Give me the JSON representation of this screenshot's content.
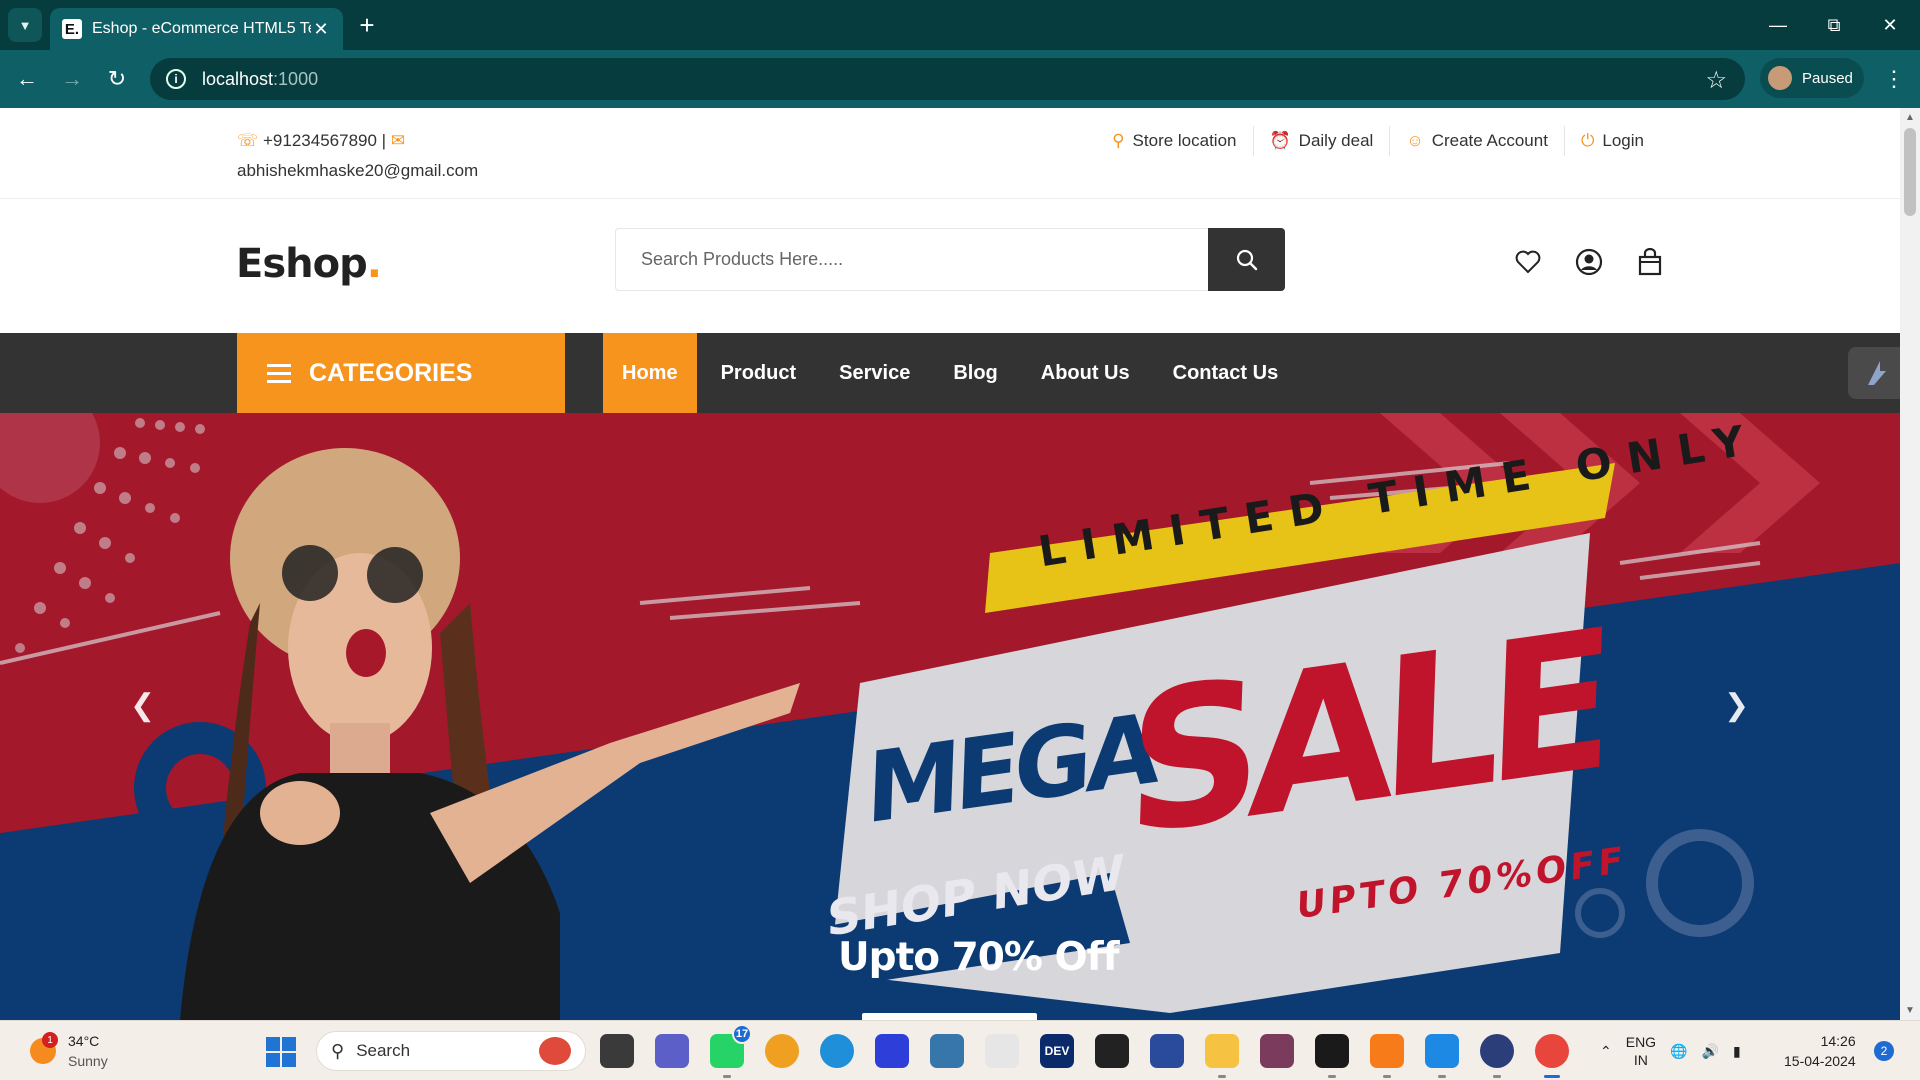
{
  "browser": {
    "tab_title": "Eshop - eCommerce HTML5 Te",
    "favicon": "E.",
    "url_host": "localhost",
    "url_port": ":1000",
    "profile_label": "Paused"
  },
  "topbar": {
    "phone": "+91234567890 |",
    "email": "abhishekmhaske20@gmail.com",
    "links": [
      {
        "label": "Store location",
        "icon": "location-pin-icon"
      },
      {
        "label": "Daily deal",
        "icon": "alarm-clock-icon"
      },
      {
        "label": "Create Account",
        "icon": "user-icon"
      },
      {
        "label": "Login",
        "icon": "power-icon"
      }
    ]
  },
  "header": {
    "logo_text": "Eshop",
    "logo_dot": ".",
    "search_placeholder": "Search Products Here....."
  },
  "nav": {
    "categories_label": "CATEGORIES",
    "items": [
      "Home",
      "Product",
      "Service",
      "Blog",
      "About Us",
      "Contact Us"
    ],
    "active": "Home"
  },
  "hero": {
    "banner_line1": "LIMITED TIME ONLY",
    "banner_mega": "MEGA",
    "banner_sale": "SALE",
    "banner_shop": "SHOP NOW",
    "banner_upto": "UPTO 70%OFF",
    "caption": "Upto 70% Off"
  },
  "taskbar": {
    "temperature": "34°C",
    "condition": "Sunny",
    "weather_badge": "1",
    "search_label": "Search",
    "whatsapp_badge": "17",
    "lang_line1": "ENG",
    "lang_line2": "IN",
    "time": "14:26",
    "date": "15-04-2024",
    "notifications": "2"
  },
  "colors": {
    "accent": "#f7941d",
    "nav_bg": "#333333",
    "chrome_dark": "#063c3e",
    "chrome_toolbar": "#0f6066",
    "hero_red": "#a3182b",
    "hero_blue": "#0c3a73"
  }
}
